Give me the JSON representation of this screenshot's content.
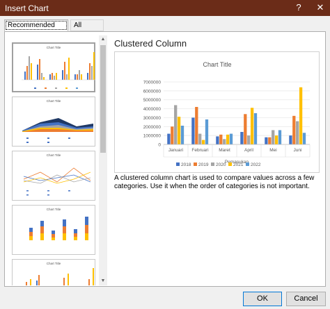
{
  "window": {
    "title": "Insert Chart",
    "help_glyph": "?",
    "close_glyph": "✕"
  },
  "tabs": [
    {
      "label": "Recommended Charts",
      "active": true
    },
    {
      "label": "All Charts",
      "active": false
    }
  ],
  "thumbnails": [
    {
      "kind": "clustered-column",
      "title": "Chart Title",
      "selected": true
    },
    {
      "kind": "stacked-area",
      "title": "Chart Title",
      "selected": false
    },
    {
      "kind": "line",
      "title": "Chart Title",
      "selected": false
    },
    {
      "kind": "stacked-column",
      "title": "Chart Title",
      "selected": false
    },
    {
      "kind": "clustered-column",
      "title": "Chart Title",
      "selected": false
    }
  ],
  "scrollbar": {
    "up_glyph": "▲",
    "down_glyph": "▼"
  },
  "preview": {
    "name": "Clustered Column",
    "description": "A clustered column chart is used to compare values across a few categories. Use it when the order of categories is not important."
  },
  "chart_data": {
    "type": "bar",
    "title": "Chart Title",
    "xlabel": "Pemasukan",
    "ylabel": "",
    "categories": [
      "Januari",
      "Februari",
      "Maret",
      "April",
      "Mei",
      "Juni"
    ],
    "ylim": [
      0,
      7000000
    ],
    "yticks": [
      "0",
      "1000000",
      "2000000",
      "3000000",
      "4000000",
      "5000000",
      "6000000",
      "7000000"
    ],
    "series": [
      {
        "name": "2018",
        "color": "#4472c4",
        "values": [
          1200000,
          3000000,
          900000,
          1400000,
          800000,
          1000000
        ]
      },
      {
        "name": "2019",
        "color": "#ed7d31",
        "values": [
          2000000,
          4200000,
          1100000,
          3400000,
          800000,
          3200000
        ]
      },
      {
        "name": "2020",
        "color": "#a5a5a5",
        "values": [
          4400000,
          1200000,
          600000,
          1000000,
          1600000,
          2600000
        ]
      },
      {
        "name": "2021",
        "color": "#ffc000",
        "values": [
          3100000,
          500000,
          1100000,
          4100000,
          1000000,
          6400000
        ]
      },
      {
        "name": "2022",
        "color": "#5b9bd5",
        "values": [
          2100000,
          2800000,
          1200000,
          3500000,
          1600000,
          1300000
        ]
      }
    ],
    "legend_position": "bottom"
  },
  "buttons": {
    "ok": "OK",
    "cancel": "Cancel"
  }
}
